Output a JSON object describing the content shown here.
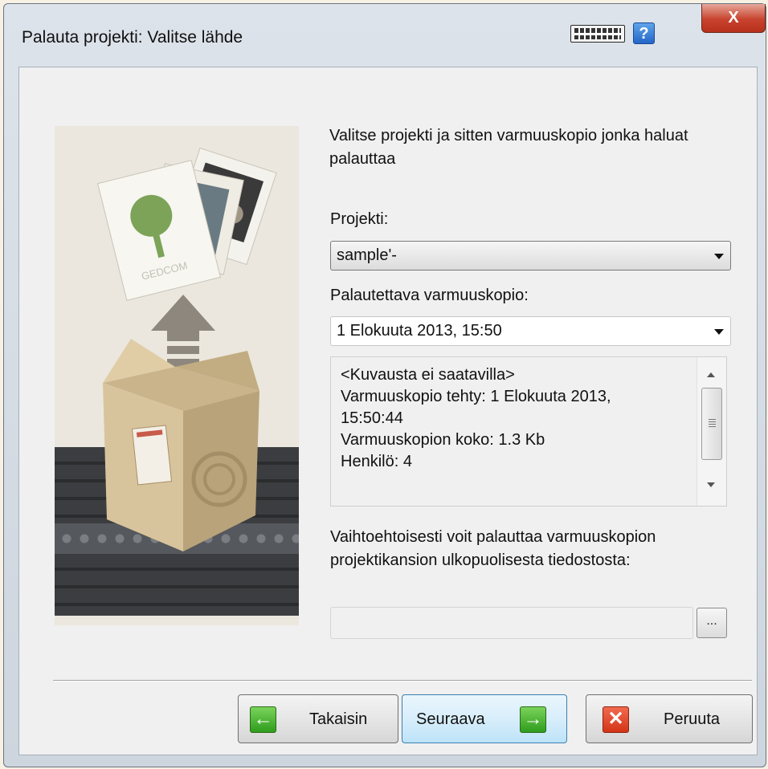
{
  "window": {
    "title": "Palauta projekti: Valitse lähde",
    "help_label": "?",
    "close_label": "X"
  },
  "main": {
    "instructions": "Valitse projekti ja sitten varmuuskopio jonka haluat palauttaa",
    "project_label": "Projekti:",
    "project_value": "sample'-",
    "backup_label": "Palautettava varmuuskopio:",
    "backup_value": "1 Elokuuta 2013, 15:50",
    "details_lines": [
      "<Kuvausta ei saatavilla>",
      "Varmuuskopio tehty: 1 Elokuuta 2013,",
      "15:50:44",
      "Varmuuskopion koko: 1.3 Kb",
      "Henkilö: 4"
    ],
    "alternative_text": "Vaihtoehtoisesti voit palauttaa varmuuskopion projektikansion ulkopuolisesta tiedostosta:",
    "file_path_value": "",
    "browse_label": "..."
  },
  "illustration": {
    "card_text": "GEDCOM"
  },
  "buttons": {
    "back_label": "Takaisin",
    "next_label": "Seuraava",
    "cancel_label": "Peruuta"
  },
  "colors": {
    "next_button_bg": "#d8eefb",
    "green_icon": "#2e9d1e",
    "red_icon": "#d43417",
    "close_button": "#c8432e"
  }
}
